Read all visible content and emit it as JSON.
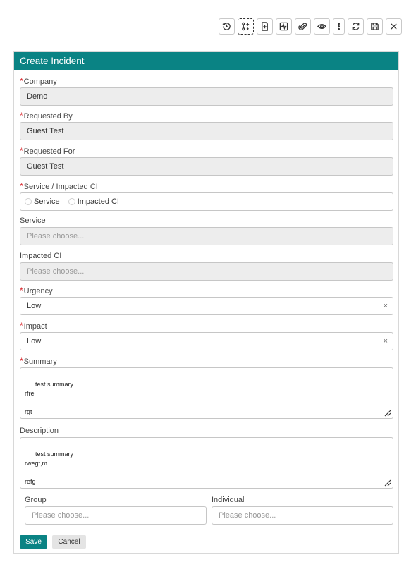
{
  "toolbar": {
    "icons": [
      "history-icon",
      "split-icon",
      "new-document-icon",
      "activity-icon",
      "attachment-icon",
      "view-icon",
      "more-icon",
      "refresh-icon",
      "save-icon",
      "close-icon"
    ]
  },
  "panel": {
    "title": "Create Incident"
  },
  "form": {
    "company": {
      "label": "Company",
      "value": "Demo"
    },
    "requested_by": {
      "label": "Requested By",
      "value": "Guest Test"
    },
    "requested_for": {
      "label": "Requested For",
      "value": "Guest Test"
    },
    "service_impacted": {
      "label": "Service / Impacted CI",
      "option_service": "Service",
      "option_ci": "Impacted CI"
    },
    "service": {
      "label": "Service",
      "placeholder": "Please choose..."
    },
    "impacted_ci": {
      "label": "Impacted CI",
      "placeholder": "Please choose..."
    },
    "urgency": {
      "label": "Urgency",
      "value": "Low"
    },
    "impact": {
      "label": "Impact",
      "value": "Low"
    },
    "summary": {
      "label": "Summary",
      "value": "test summary\nrfre\n\nrgt"
    },
    "description": {
      "label": "Description",
      "value": "test summary\nrwegt,m\n\nrefg"
    },
    "group": {
      "label": "Group",
      "placeholder": "Please choose..."
    },
    "individual": {
      "label": "Individual",
      "placeholder": "Please choose..."
    },
    "clear_glyph": "×"
  },
  "actions": {
    "save_label": "Save",
    "cancel_label": "Cancel"
  }
}
